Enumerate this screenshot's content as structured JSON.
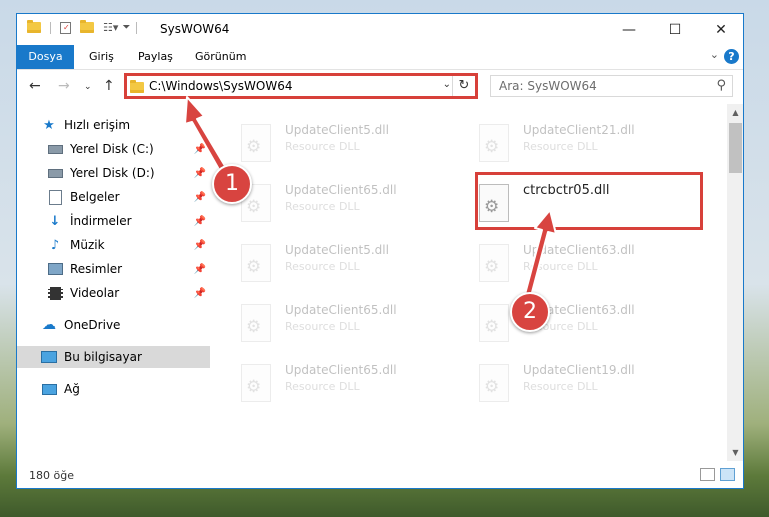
{
  "window": {
    "title": "SysWOW64",
    "controls": {
      "minimize": "—",
      "maximize": "☐",
      "close": "✕"
    }
  },
  "ribbon": {
    "tabs": [
      {
        "label": "Dosya",
        "active": true
      },
      {
        "label": "Giriş",
        "active": false
      },
      {
        "label": "Paylaş",
        "active": false
      },
      {
        "label": "Görünüm",
        "active": false
      }
    ],
    "help": "?"
  },
  "address": {
    "path": "C:\\Windows\\SysWOW64",
    "search_placeholder": "Ara: SysWOW64"
  },
  "sidebar": {
    "items": [
      {
        "label": "Hızlı erişim",
        "icon": "star-icon",
        "pinned": false
      },
      {
        "label": "Yerel Disk (C:)",
        "icon": "drive-icon",
        "pinned": true
      },
      {
        "label": "Yerel Disk (D:)",
        "icon": "drive-icon",
        "pinned": true
      },
      {
        "label": "Belgeler",
        "icon": "documents-icon",
        "pinned": true
      },
      {
        "label": "İndirmeler",
        "icon": "download-icon",
        "pinned": true
      },
      {
        "label": "Müzik",
        "icon": "music-icon",
        "pinned": true
      },
      {
        "label": "Resimler",
        "icon": "pictures-icon",
        "pinned": true
      },
      {
        "label": "Videolar",
        "icon": "videos-icon",
        "pinned": true
      },
      {
        "label": "OneDrive",
        "icon": "cloud-icon",
        "pinned": false
      },
      {
        "label": "Bu bilgisayar",
        "icon": "computer-icon",
        "pinned": false,
        "selected": true
      },
      {
        "label": "Ağ",
        "icon": "network-icon",
        "pinned": false
      }
    ]
  },
  "files": [
    {
      "name": "UpdateClient5.dll",
      "type": "Resource DLL"
    },
    {
      "name": "UpdateClient21.dll",
      "type": "Resource DLL"
    },
    {
      "name": "UpdateClient65.dll",
      "type": "Resource DLL"
    },
    {
      "name": "ctrcbctr05.dll",
      "type": "",
      "highlighted": true
    },
    {
      "name": "UpdateClient5.dll",
      "type": "Resource DLL"
    },
    {
      "name": "UpdateClient63.dll",
      "type": "Resource DLL"
    },
    {
      "name": "UpdateClient65.dll",
      "type": "Resource DLL"
    },
    {
      "name": "UpdateClient63.dll",
      "type": "Resource DLL"
    },
    {
      "name": "UpdateClient65.dll",
      "type": "Resource DLL"
    },
    {
      "name": "UpdateClient19.dll",
      "type": "Resource DLL"
    }
  ],
  "status": {
    "count": "180 öğe"
  },
  "annotations": {
    "step1": "1",
    "step2": "2",
    "color": "#d84440"
  }
}
